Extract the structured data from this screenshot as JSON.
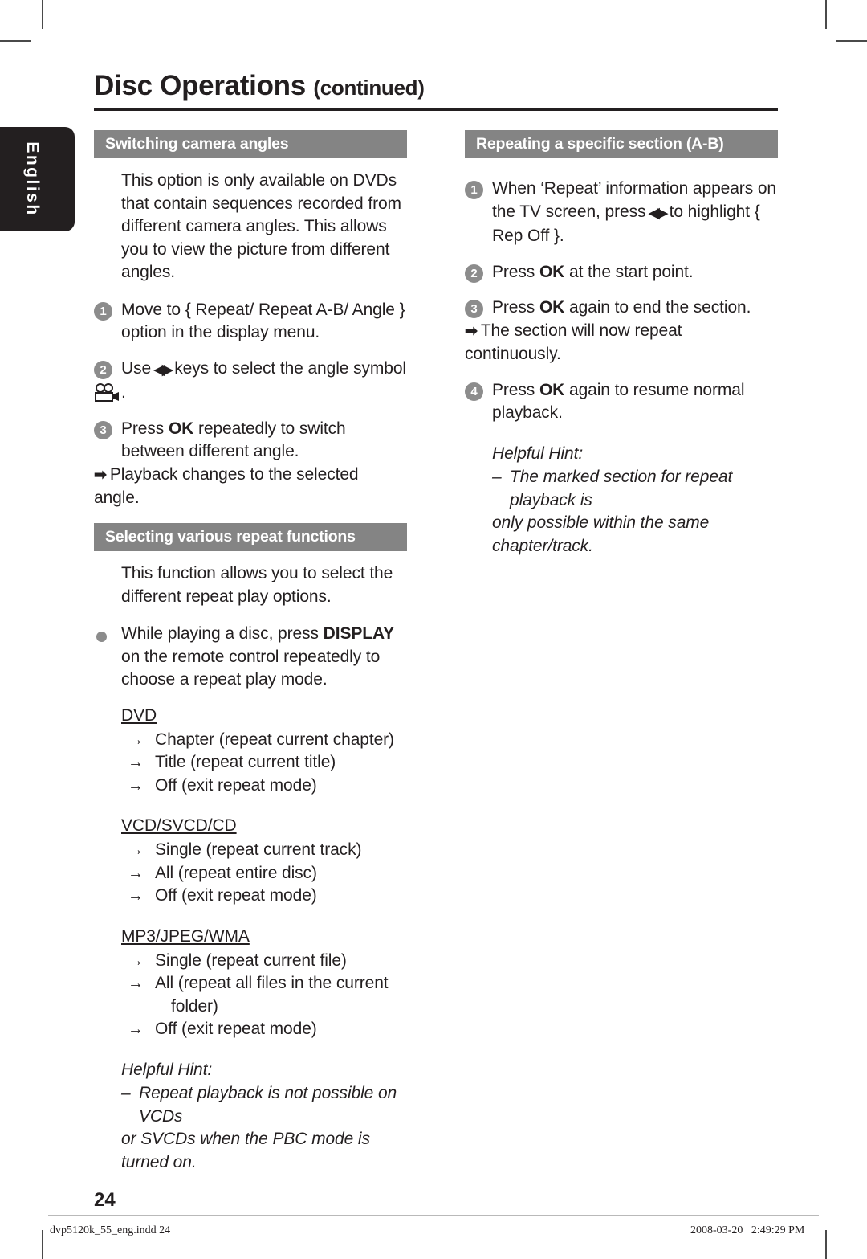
{
  "language_tab": {
    "label": "English"
  },
  "header": {
    "title": "Disc Operations",
    "continued": "(continued)"
  },
  "left_column": {
    "section1": {
      "heading": "Switching camera angles",
      "intro": "This option is only available on DVDs that contain sequences recorded from different camera angles. This allows you to view the picture from different angles.",
      "steps": [
        {
          "num": "1",
          "text": "Move to { Repeat/ Repeat A-B/ Angle } option in the display menu."
        },
        {
          "num": "2",
          "text_before": "Use",
          "keys_icon": "left-right-nav-keys",
          "text_after": "keys to select the angle symbol",
          "trailing_icon": "camera-angle-icon",
          "trailing_text": "."
        },
        {
          "num": "3",
          "text_before": "Press",
          "emphasis": "OK",
          "text_after": "repeatedly to switch between different angle.",
          "result": "Playback changes to the selected angle."
        }
      ]
    },
    "section2": {
      "heading": "Selecting various repeat functions",
      "intro": "This function allows you to select the different repeat play options.",
      "bullet": {
        "text_before": "While playing a disc, press",
        "emphasis": "DISPLAY",
        "text_after": "on the remote control repeatedly to choose a repeat play mode."
      },
      "disc_groups": [
        {
          "type": "DVD",
          "options": [
            "Chapter (repeat current chapter)",
            "Title (repeat current title)",
            "Off (exit repeat mode)"
          ]
        },
        {
          "type": "VCD/SVCD/CD",
          "options": [
            "Single (repeat current track)",
            "All (repeat entire disc)",
            "Off (exit repeat mode)"
          ]
        },
        {
          "type": "MP3/JPEG/WMA",
          "options": [
            "Single (repeat current file)",
            "All (repeat all files in the current",
            "Off (exit repeat mode)"
          ],
          "option_continuation": "folder)"
        }
      ],
      "hint": {
        "title": "Helpful Hint:",
        "dash": "–",
        "line1": "Repeat playback is not possible on VCDs",
        "line2": "or SVCDs when the PBC mode is turned on."
      }
    }
  },
  "right_column": {
    "section1": {
      "heading": "Repeating a specific section (A-B)",
      "steps": [
        {
          "num": "1",
          "text_before": "When ‘Repeat’ information appears on the TV screen, press",
          "keys_icon": "left-right-nav-keys",
          "text_after": "to highlight { Rep Off }."
        },
        {
          "num": "2",
          "text_before": "Press",
          "emphasis": "OK",
          "text_after": "at the start point."
        },
        {
          "num": "3",
          "text_before": "Press",
          "emphasis": "OK",
          "text_after": "again to end the section.",
          "result": "The section will now repeat continuously."
        },
        {
          "num": "4",
          "text_before": "Press",
          "emphasis": "OK",
          "text_after": "again to resume normal playback."
        }
      ],
      "hint": {
        "title": "Helpful Hint:",
        "dash": "–",
        "line1": "The marked section for repeat playback is",
        "line2": "only possible within the same chapter/track."
      }
    }
  },
  "page_number": "24",
  "footer": {
    "file": "dvp5120k_55_eng.indd   24",
    "timestamp": "2008-03-20   2:49:29 PM"
  },
  "colors": {
    "section_heading_bg": "#848484",
    "tab_bg": "#231f20",
    "step_badge": "#8c8c8c",
    "text": "#231f20"
  }
}
